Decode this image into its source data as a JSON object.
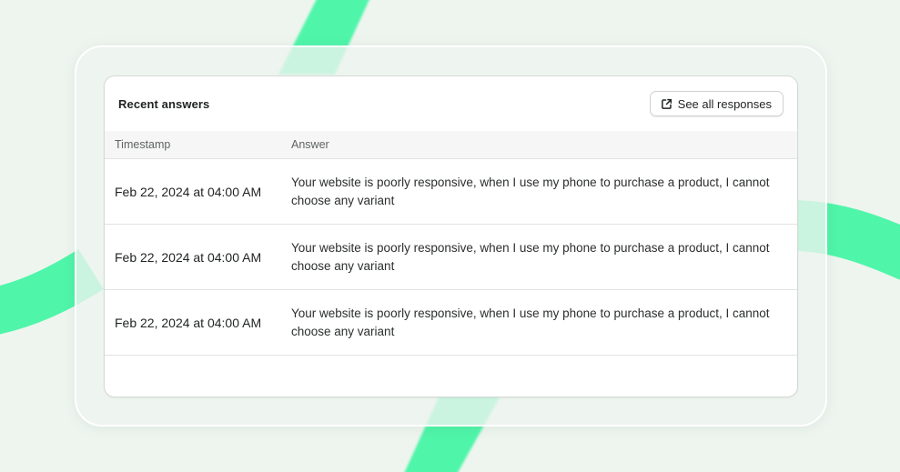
{
  "card": {
    "title": "Recent answers",
    "see_all_label": "See all responses",
    "icons": {
      "see_all": "external-link-icon"
    }
  },
  "table": {
    "columns": [
      "Timestamp",
      "Answer"
    ],
    "rows": [
      {
        "timestamp": "Feb 22, 2024 at 04:00 AM",
        "answer": "Your website is poorly responsive, when I use my phone to purchase a product, I cannot choose any variant"
      },
      {
        "timestamp": "Feb 22, 2024 at 04:00 AM",
        "answer": "Your website is poorly responsive, when I use my phone to purchase a product, I cannot choose any variant"
      },
      {
        "timestamp": "Feb 22, 2024 at 04:00 AM",
        "answer": "Your website is poorly responsive, when I use my phone to purchase a product, I cannot choose any variant"
      }
    ]
  },
  "colors": {
    "background": "#eef5ef",
    "accent_ribbon": "#4ff5a9",
    "card": "#ffffff",
    "text": "#1f2321",
    "muted_text": "#5f6462"
  }
}
